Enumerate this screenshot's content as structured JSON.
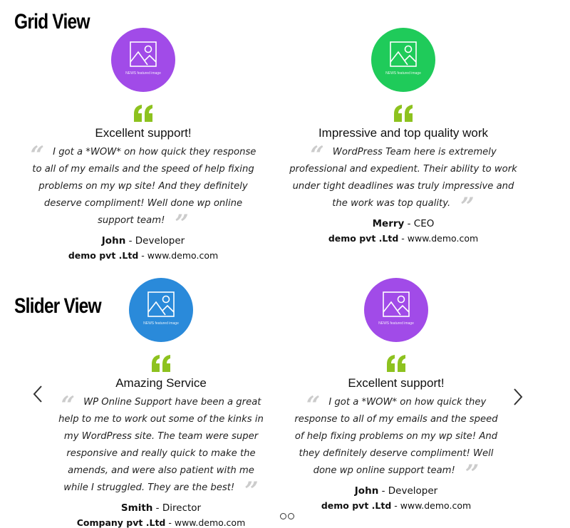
{
  "grid_view": {
    "label": "Grid View",
    "cards": [
      {
        "avatar_color": "#a14be8",
        "avatar_caption": "NEWS featured image",
        "title": "Excellent support!",
        "text": "I got a *WOW* on how quick they response to all of my emails and the speed of help fixing problems on my wp site! And they definitely deserve compliment! Well done wp online support team!",
        "name": "John",
        "role": "Developer",
        "company": "demo pvt .Ltd",
        "website": "www.demo.com"
      },
      {
        "avatar_color": "#1fcb5a",
        "avatar_caption": "NEWS featured image",
        "title": "Impressive and top quality work",
        "text": "WordPress Team here is extremely professional and expedient. Their ability to work under tight deadlines was truly impressive and the work was top quality.",
        "name": "Merry",
        "role": "CEO",
        "company": "demo pvt .Ltd",
        "website": "www.demo.com"
      }
    ]
  },
  "slider_view": {
    "label": "Slider View",
    "prev_label": "‹",
    "next_label": "›",
    "dots_count": 2,
    "cards": [
      {
        "avatar_color": "#2a8ada",
        "avatar_caption": "NEWS featured image",
        "title": "Amazing Service",
        "text": "WP Online Support have been a great help to me to work out some of the kinks in my WordPress site. The team were super responsive and really quick to make the amends, and were also patient with me while I struggled. They are the best!",
        "name": "Smith",
        "role": "Director",
        "company": "Company pvt .Ltd",
        "website": "www.demo.com"
      },
      {
        "avatar_color": "#a14be8",
        "avatar_caption": "NEWS featured image",
        "title": "Excellent support!",
        "text": "I got a *WOW* on how quick they response to all of my emails and the speed of help fixing problems on my wp site! And they definitely deserve compliment! Well done wp online support team!",
        "name": "John",
        "role": "Developer",
        "company": "demo pvt .Ltd",
        "website": "www.demo.com"
      }
    ]
  },
  "colors": {
    "quote_icon": "#8dc21f",
    "quote_marks": "#cccccc"
  },
  "separator": " - "
}
